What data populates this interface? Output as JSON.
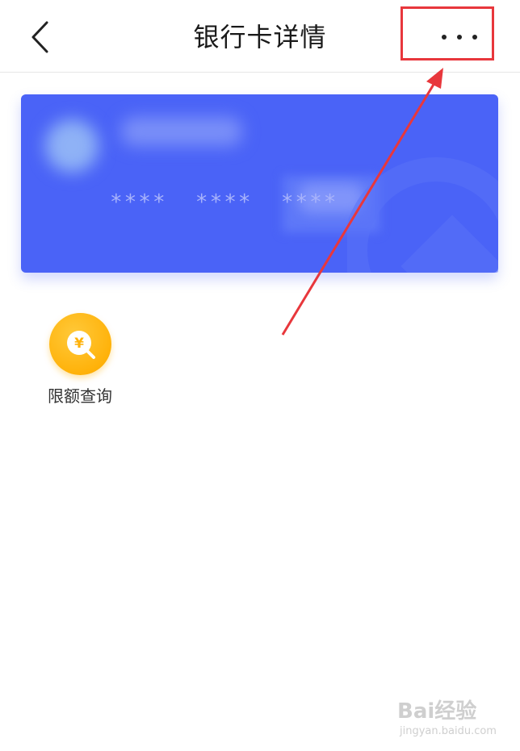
{
  "header": {
    "title": "银行卡详情",
    "back_icon": "chevron-left-icon",
    "more_icon": "more-dots-icon"
  },
  "card": {
    "masked_number": "****  ****  ****",
    "color": "#4a63f7"
  },
  "functions": [
    {
      "label": "限额查询",
      "icon": "yen-search-icon",
      "icon_symbol": "¥",
      "color": "#ffb20a"
    }
  ],
  "annotation": {
    "color": "#e8373c"
  },
  "watermark": {
    "logo_text": "Bai经验",
    "url": "jingyan.baidu.com"
  }
}
